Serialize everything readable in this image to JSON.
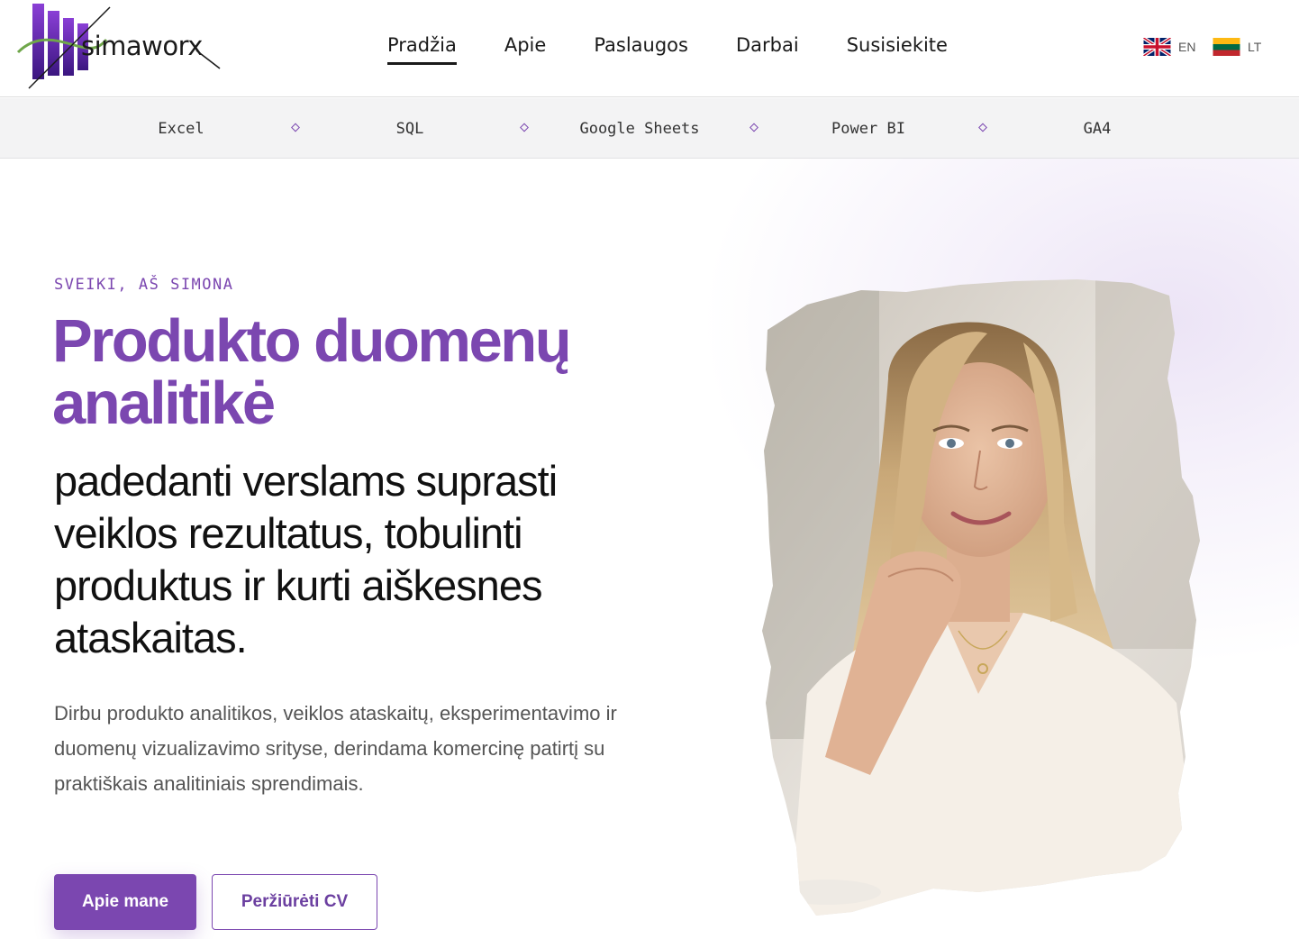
{
  "brand": {
    "name": "simaworx",
    "accent_color": "#7b47b0",
    "logo_icon": "bar-chart-logo-icon"
  },
  "nav": {
    "items": [
      {
        "label": "Pradžia",
        "active": true
      },
      {
        "label": "Apie",
        "active": false
      },
      {
        "label": "Paslaugos",
        "active": false
      },
      {
        "label": "Darbai",
        "active": false
      },
      {
        "label": "Susisiekite",
        "active": false
      }
    ]
  },
  "languages": [
    {
      "code": "EN",
      "flag": "uk-flag-icon"
    },
    {
      "code": "LT",
      "flag": "lithuania-flag-icon"
    }
  ],
  "skills": [
    "Excel",
    "SQL",
    "Google Sheets",
    "Power BI",
    "GA4"
  ],
  "hero": {
    "eyebrow": "SVEIKI, AŠ SIMONA",
    "headline": "Produkto duomenų analitikė",
    "subheadline": "padedanti verslams suprasti veiklos rezultatus, tobulinti produktus ir kurti aiškesnes ataskaitas.",
    "description": "Dirbu produkto analitikos, veiklos ataskaitų, eksperimentavimo ir duomenų vizualizavimo srityse, derindama komercinę patirtį su praktiškais analitiniais sprendimais.",
    "primary_button": "Apie mane",
    "secondary_button": "Peržiūrėti CV",
    "portrait": "portrait-photo"
  }
}
